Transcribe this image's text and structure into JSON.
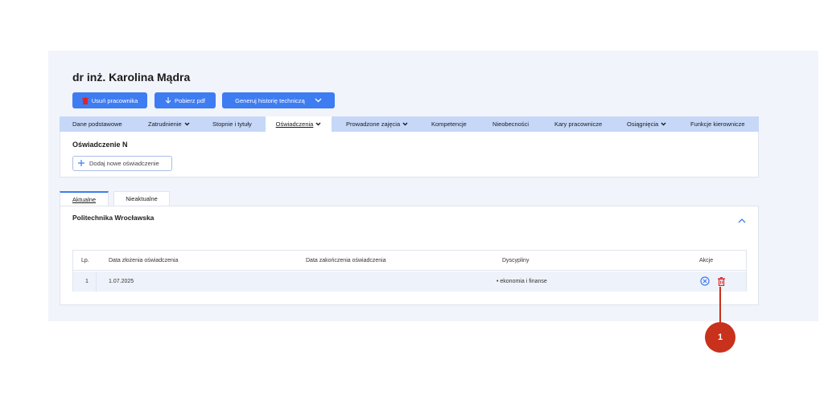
{
  "employee": {
    "name": "dr inż. Karolina Mądra"
  },
  "actions": {
    "delete_label": "Usuń pracownika",
    "download_label": "Pobierz pdf",
    "generate_label": "Generuj historię techniczą"
  },
  "tabs": [
    {
      "label": "Dane podstawowe",
      "dropdown": false
    },
    {
      "label": "Zatrudnienie",
      "dropdown": true
    },
    {
      "label": "Stopnie i tytuły",
      "dropdown": false
    },
    {
      "label": "Oświadczenia",
      "dropdown": true,
      "active": true
    },
    {
      "label": "Prowadzone zajęcia",
      "dropdown": true
    },
    {
      "label": "Kompetencje",
      "dropdown": false
    },
    {
      "label": "Nieobecności",
      "dropdown": false
    },
    {
      "label": "Kary pracownicze",
      "dropdown": false
    },
    {
      "label": "Osiągnięcia",
      "dropdown": true
    },
    {
      "label": "Funkcje kierownicze",
      "dropdown": false
    }
  ],
  "section": {
    "title": "Oświadczenie N",
    "add_label": "Dodaj nowe oświadczenie"
  },
  "subtabs": {
    "current": "Aktualne",
    "outdated": "Nieaktualne"
  },
  "institution": {
    "name": "Politechnika Wrocławska"
  },
  "table": {
    "headers": {
      "lp": "Lp.",
      "date_submitted": "Data złożenia oświadczenia",
      "date_end": "Data zakończenia oświadczenia",
      "disciplines": "Dyscypliny",
      "actions": "Akcje"
    },
    "rows": [
      {
        "lp": "1",
        "date_submitted": "1.07.2025",
        "date_end": "",
        "disciplines": "• ekonomia i finanse"
      }
    ]
  },
  "callout": {
    "number": "1"
  },
  "colors": {
    "primary": "#3e7cf2",
    "tab_bar": "#c6d7f7",
    "danger": "#c8311b",
    "panel": "#f1f4fb"
  },
  "icons": {
    "delete": "trash-icon",
    "download": "download-icon",
    "expand": "chevron-down-icon",
    "collapse": "chevron-up-icon",
    "add": "plus-icon",
    "cancel": "circle-x-icon"
  }
}
